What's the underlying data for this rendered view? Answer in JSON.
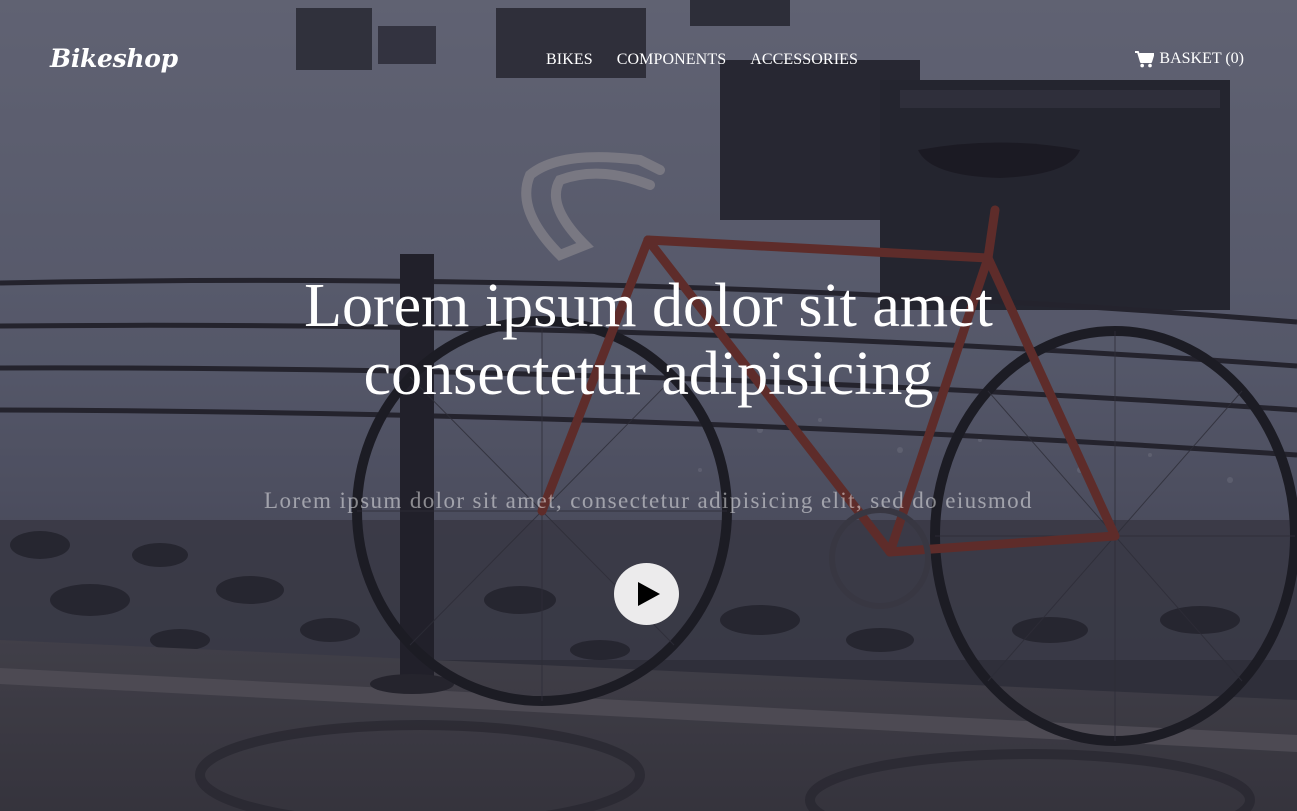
{
  "brand": {
    "name": "Bikeshop"
  },
  "nav": {
    "items": [
      {
        "label": "BIKES"
      },
      {
        "label": "COMPONENTS"
      },
      {
        "label": "ACCESSORIES"
      }
    ],
    "basket": {
      "label": "BASKET (0)",
      "icon": "shopping-cart-icon"
    }
  },
  "hero": {
    "headline_line1": "Lorem ipsum dolor sit amet",
    "headline_line2": "consectetur adipisicing",
    "subtitle": "Lorem ipsum dolor sit amet, consectetur adipisicing elit, sed do eiusmod",
    "play_icon": "play-icon",
    "background": "bicycle-by-railing-at-waterfront"
  },
  "colors": {
    "text": "#ffffff",
    "play_button_bg": "#ecebec",
    "overlay": "#1c1a26",
    "bike_frame": "#8a3a2e"
  }
}
